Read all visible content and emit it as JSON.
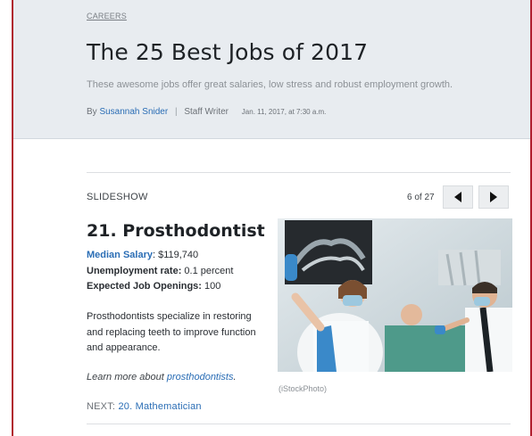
{
  "article": {
    "category": "CAREERS",
    "headline": "The 25 Best Jobs of 2017",
    "dek": "These awesome jobs offer great salaries, low stress and robust employment growth.",
    "byline_prefix": "By",
    "author": "Susannah Snider",
    "byline_sep": "|",
    "role": "Staff Writer",
    "date": "Jan. 11, 2017, at 7:30 a.m."
  },
  "slideshow": {
    "label": "SLIDESHOW",
    "counter": "6 of 27",
    "prev_icon": "triangle-left-icon",
    "next_icon": "triangle-right-icon"
  },
  "slide": {
    "title": "21. Prosthodontist",
    "median_salary_label": "Median Salary",
    "median_salary_value": ": $119,740",
    "unemployment_label": "Unemployment rate:",
    "unemployment_value": " 0.1 percent",
    "openings_label": "Expected Job Openings:",
    "openings_value": " 100",
    "description": "Prosthodontists specialize in restoring and replacing teeth to improve function and appearance.",
    "learn_prefix": "Learn more about ",
    "learn_link": "prosthodontists",
    "learn_suffix": ".",
    "next_prefix": "NEXT: ",
    "next_link": "20. Mathematician",
    "photo_credit": "(iStockPhoto)"
  },
  "colors": {
    "border": "#b01e2e",
    "header_bg": "#e8ecf0",
    "link": "#2a6db5"
  }
}
